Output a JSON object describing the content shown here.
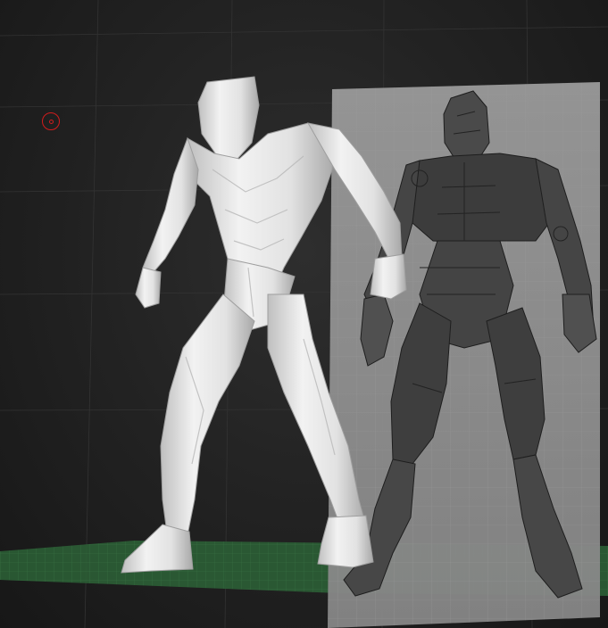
{
  "app": {
    "mode": "3d-sculpt-viewport"
  },
  "scene": {
    "floor_color": "#2f6b3a",
    "grid_color": "#3a3a3a",
    "background_center": "#2e2e2e",
    "background_edge": "#171717",
    "model_color": "#e8e8e8",
    "reference_plane_color": "#8c8c8c",
    "cursor_color": "#d11c1c"
  },
  "icons": {
    "brush_cursor": "circle-cursor-icon"
  }
}
